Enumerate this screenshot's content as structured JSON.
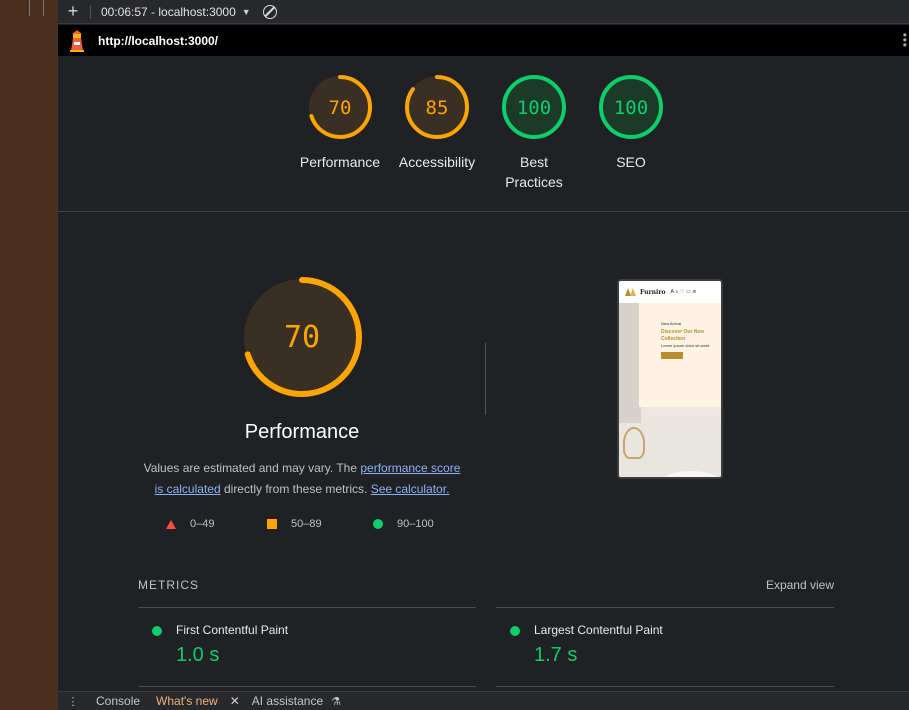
{
  "devtools": {
    "session_label": "00:06:57 - localhost:3000",
    "add_icon": "plus-icon",
    "dropdown_icon": "caret-down-icon",
    "clear_icon": "block-icon"
  },
  "report": {
    "url": "http://localhost:3000/",
    "logo_icon": "lighthouse-icon"
  },
  "categories": [
    {
      "score": "70",
      "label": "Performance",
      "status": "average"
    },
    {
      "score": "85",
      "label": "Accessibility",
      "status": "average"
    },
    {
      "score": "100",
      "label": "Best\nPractices",
      "status": "pass"
    },
    {
      "score": "100",
      "label": "SEO",
      "status": "pass"
    }
  ],
  "colors": {
    "pass": "#0cce6b",
    "average": "#ffa400",
    "fail": "#ff4e42",
    "link": "#8ab4f8"
  },
  "performance": {
    "score": "70",
    "title": "Performance",
    "desc_prefix": "Values are estimated and may vary. The ",
    "desc_link1": "performance score is calculated",
    "desc_middle": " directly from these metrics. ",
    "desc_link2": "See calculator.",
    "legend": [
      {
        "shape": "triangle",
        "range": "0–49"
      },
      {
        "shape": "square",
        "range": "50–89"
      },
      {
        "shape": "circle",
        "range": "90–100"
      }
    ]
  },
  "screenshot": {
    "brand": "Furniro",
    "kicker": "New Arrival",
    "headline": "Discover Our New Collection",
    "body": "Lorem ipsum dolor sit amet",
    "button": "Buy Now"
  },
  "metrics": {
    "title": "METRICS",
    "expand": "Expand view",
    "items": [
      {
        "name": "First Contentful Paint",
        "value": "1.0 s"
      },
      {
        "name": "Largest Contentful Paint",
        "value": "1.7 s"
      }
    ]
  },
  "drawer": {
    "menu_icon": "kebab-icon",
    "tabs": [
      {
        "label": "Console"
      },
      {
        "label": "What's new"
      },
      {
        "label": "AI assistance"
      }
    ],
    "close_icon": "close-icon",
    "flask_icon": "flask-icon"
  }
}
